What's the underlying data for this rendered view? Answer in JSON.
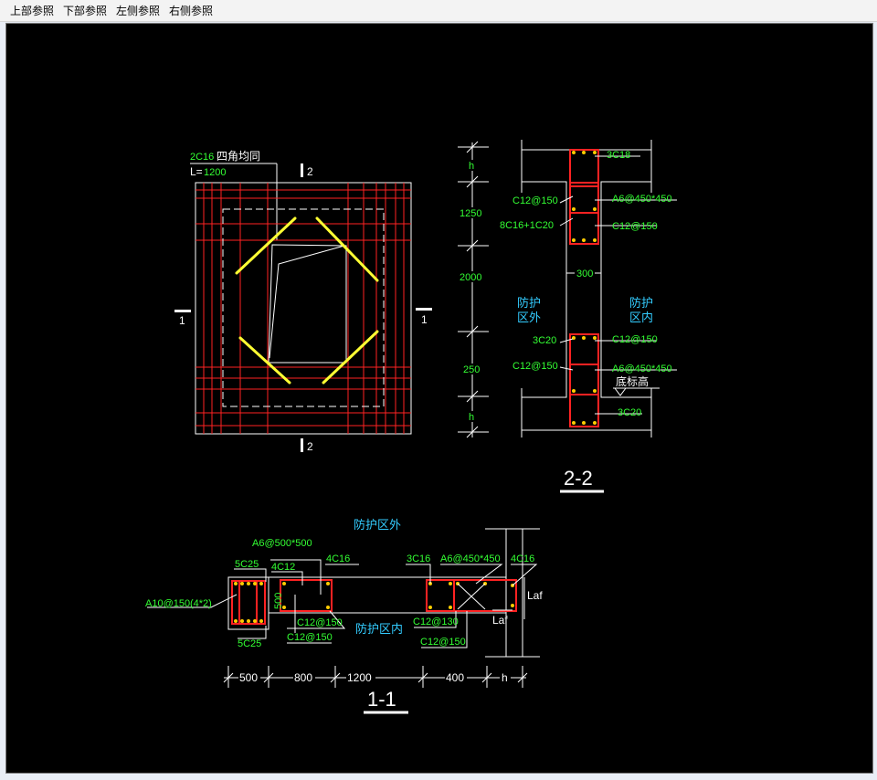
{
  "menu": {
    "items": [
      "上部参照",
      "下部参照",
      "左侧参照",
      "右侧参照"
    ]
  },
  "colors": {
    "background": "#000000",
    "rebar": "#ff2222",
    "corner_bar": "#ffff33",
    "dimension_text": "#33ff33",
    "zone_text": "#33ccff",
    "line": "#ffffff"
  },
  "plan": {
    "corner_bar_label": "2C16",
    "corner_bar_note": "四角均同",
    "length_label": "L=",
    "length_value": "1200",
    "section_2_mark": "2",
    "section_1_mark": "1"
  },
  "section22": {
    "title": "2-2",
    "dims": [
      "h",
      "1250",
      "2000",
      "250",
      "h"
    ],
    "labels": {
      "top_bars": "3C18",
      "stirrup_left_top": "C12@150",
      "tie_top": "A6@450*450",
      "side_bars": "8C16+1C20",
      "stirrup_right_top": "C12@150",
      "wall_width": "300",
      "outside": "防护\n区外",
      "inside": "防护\n区内",
      "bars_left_low": "3C20",
      "stirrup_right_low": "C12@150",
      "stirrup_left_low": "C12@150",
      "tie_low": "A6@450*450",
      "bottom_elev": "底标高",
      "bottom_bars": "3C20"
    }
  },
  "section11": {
    "title": "1-1",
    "outside": "防护区外",
    "inside": "防护区内",
    "labels": {
      "tie_left": "A6@500*500",
      "col_bars_top": "5C25",
      "col_bars_top2": "4C12",
      "beam_bars_left": "4C16",
      "beam_bars_mid": "3C16",
      "tie_right": "A6@450*450",
      "beam_bars_right": "4C16",
      "col_stirrup": "A10@150",
      "col_stirrup_legs": "(4*2)",
      "col_size": "500",
      "stirrup_a": "C12@150",
      "stirrup_b": "C12@150",
      "stirrup_c": "C12@130",
      "stirrup_d": "C12@150",
      "col_bars_bottom": "5C25",
      "laf1": "Laf",
      "laf2": "Laf"
    },
    "dims": [
      "500",
      "800",
      "1200",
      "400",
      "h"
    ]
  }
}
